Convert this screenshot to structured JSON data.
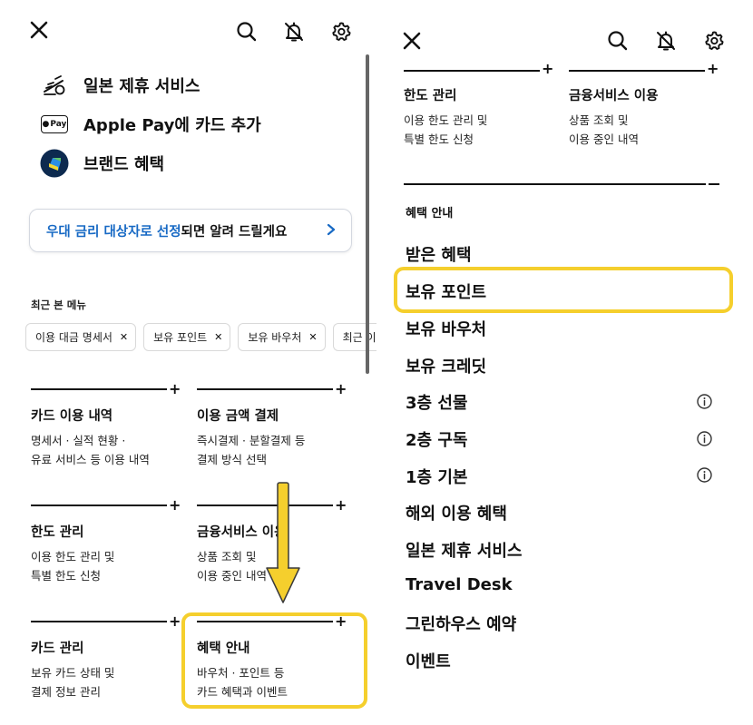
{
  "left": {
    "services": [
      {
        "label": "일본 제휴 서비스",
        "icon": "japan-service-icon"
      },
      {
        "label": "Apple Pay에 카드 추가",
        "icon": "apple-pay-icon"
      },
      {
        "label": "브랜드 혜택",
        "icon": "brand-benefit-icon"
      }
    ],
    "apple_pay_badge": "Pay",
    "banner": {
      "highlight": "우대 금리 대상자로 선정",
      "rest": "되면 알려 드릴게요"
    },
    "recent_label": "최근 본 메뉴",
    "chips": [
      "이용 대금 명세서",
      "보유 포인트",
      "보유 바우처",
      "최근 이"
    ],
    "cards": [
      {
        "title": "카드 이용 내역",
        "desc1": "명세서 · 실적 현황 ·",
        "desc2": "유료 서비스 등 이용 내역"
      },
      {
        "title": "이용 금액 결제",
        "desc1": "즉시결제 · 분할결제 등",
        "desc2": "결제 방식 선택"
      },
      {
        "title": "한도 관리",
        "desc1": "이용 한도 관리 및",
        "desc2": "특별 한도 신청"
      },
      {
        "title": "금융서비스 이용",
        "desc1": "상품 조회 및",
        "desc2": "이용 중인 내역"
      },
      {
        "title": "카드 관리",
        "desc1": "보유 카드 상태 및",
        "desc2": "결제 정보 관리"
      },
      {
        "title": "혜택 안내",
        "desc1": "바우처 · 포인트 등",
        "desc2": "카드 혜택과 이벤트"
      }
    ]
  },
  "right": {
    "cards": [
      {
        "title": "한도 관리",
        "desc1": "이용 한도 관리 및",
        "desc2": "특별 한도 신청"
      },
      {
        "title": "금융서비스 이용",
        "desc1": "상품 조회 및",
        "desc2": "이용 중인 내역"
      }
    ],
    "section_label": "혜택 안내",
    "menu": [
      {
        "label": "받은 혜택",
        "info": false
      },
      {
        "label": "보유 포인트",
        "info": false
      },
      {
        "label": "보유 바우처",
        "info": false
      },
      {
        "label": "보유 크레딧",
        "info": false
      },
      {
        "label": "3층 선물",
        "info": true
      },
      {
        "label": "2층 구독",
        "info": true
      },
      {
        "label": "1층 기본",
        "info": true
      },
      {
        "label": "해외 이용 혜택",
        "info": false
      },
      {
        "label": "일본 제휴 서비스",
        "info": false
      },
      {
        "label": "Travel Desk",
        "info": false
      },
      {
        "label": "그린하우스 예약",
        "info": false
      },
      {
        "label": "이벤트",
        "info": false
      }
    ]
  },
  "icons": {
    "close": "close-icon",
    "search": "search-icon",
    "bell": "bell-off-icon",
    "gear": "gear-icon",
    "info": "info-icon",
    "chevron": "chevron-right-icon",
    "arrow": "arrow-down-annotation"
  },
  "colors": {
    "highlight": "#f5cf2d",
    "link_blue": "#1769c4"
  }
}
